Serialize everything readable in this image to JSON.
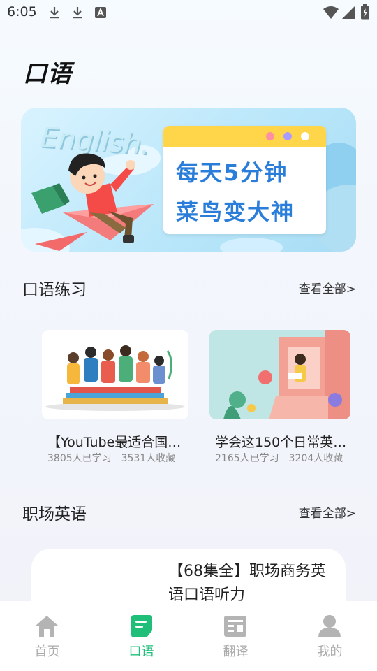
{
  "status_bar": {
    "time": "6:05",
    "icons": [
      "download-icon",
      "download-icon",
      "font-icon",
      "wifi-icon",
      "signal-icon",
      "battery-icon"
    ]
  },
  "page": {
    "title": "口语"
  },
  "banner": {
    "english_text": "English.",
    "line1": "每天5分钟",
    "line2": "菜鸟变大神",
    "dot_colors": [
      "#ff8fa3",
      "#a99bff",
      "#ffffff"
    ]
  },
  "sections": {
    "oral": {
      "title": "口语练习",
      "see_all": "查看全部>"
    },
    "work": {
      "title": "职场英语",
      "see_all": "查看全部>"
    }
  },
  "courses": [
    {
      "title": "【YouTube最适合国…",
      "learners": "3805人已学习",
      "favorites": "3531人收藏"
    },
    {
      "title": "学会这150个日常英…",
      "learners": "2165人已学习",
      "favorites": "3204人收藏"
    }
  ],
  "work_course": {
    "title": "【68集全】职场商务英语口语听力"
  },
  "tabbar": {
    "items": [
      {
        "label": "首页",
        "icon": "home-icon"
      },
      {
        "label": "口语",
        "icon": "oral-icon"
      },
      {
        "label": "翻译",
        "icon": "translate-icon"
      },
      {
        "label": "我的",
        "icon": "profile-icon"
      }
    ],
    "active_index": 1,
    "active_color": "#1fbf7a",
    "inactive_color": "#aaaaaa"
  }
}
